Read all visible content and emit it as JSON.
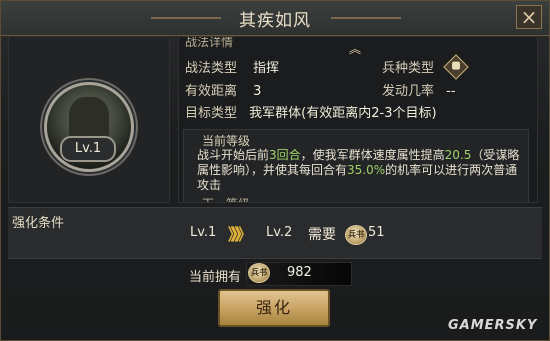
{
  "dialog": {
    "title": "其疾如风",
    "close_label": "×"
  },
  "portrait": {
    "level_badge": "Lv.1"
  },
  "detail": {
    "header": "战法详情",
    "scroll_up": "︽",
    "rows": {
      "type_label": "战法类型",
      "type_value": "指挥",
      "troop_label": "兵种类型",
      "range_label": "有效距离",
      "range_value": "3",
      "chance_label": "发动几率",
      "chance_value": "--",
      "target_label": "目标类型",
      "target_value": "我军群体(有效距离内2-3个目标)"
    },
    "current_level_title": "当前等级",
    "desc": {
      "p1": "战斗开始后前",
      "rounds": "3回合",
      "p2": "，使我军群体速度属性提高",
      "amount": "20.5",
      "p3": "（受谋略属性影响），并使其每回合有",
      "rate": "35.0%",
      "p4": "的机率可以进行两次普通攻击"
    },
    "next_level_title": "下一等级"
  },
  "upgrade": {
    "section_label": "强化条件",
    "from_level": "Lv.1",
    "arrows": "》》》",
    "to_level": "Lv.2",
    "need_label": "需要",
    "coin_icon": "coin-icon",
    "need_amount": "51",
    "coin_glyph": "兵书"
  },
  "owned": {
    "label": "当前拥有",
    "amount": "982"
  },
  "action": {
    "upgrade_button": "强化"
  },
  "watermark": "GAMERSKY",
  "colors": {
    "highlight": "#9fd16b",
    "gold_arrows": "#e1b23a",
    "button_gold": "#c9a464"
  }
}
